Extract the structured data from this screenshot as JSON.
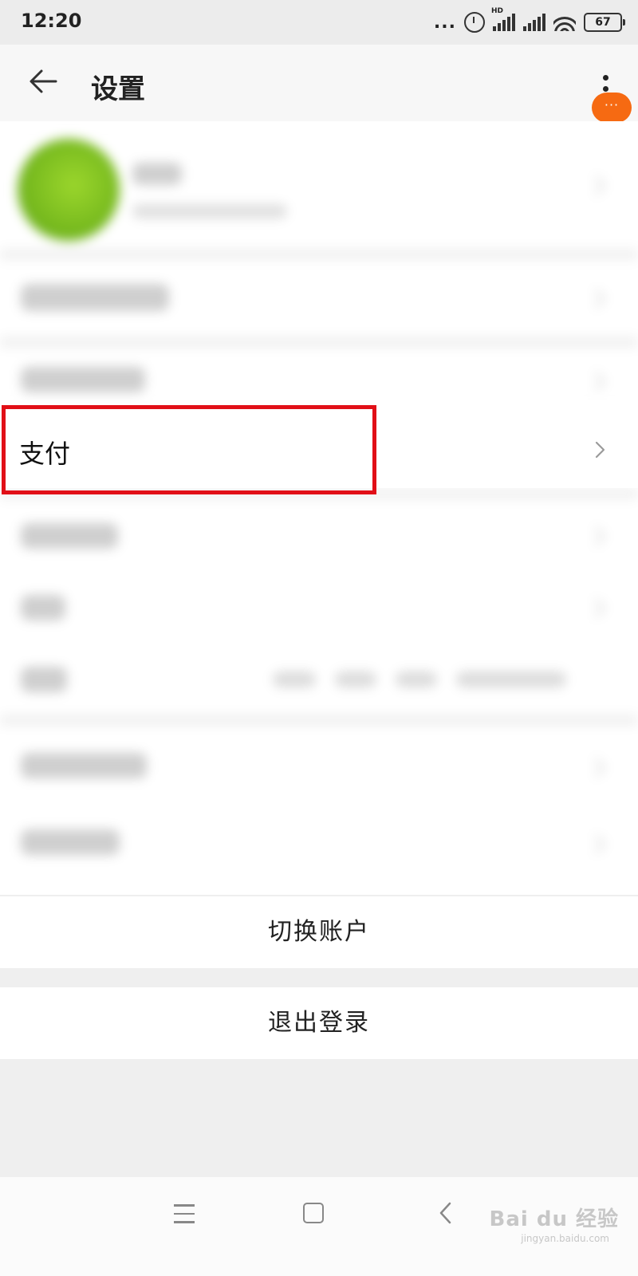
{
  "status_bar": {
    "time": "12:20",
    "dots": "...",
    "network_label": "HD",
    "battery": "67",
    "icons": [
      "alarm-icon",
      "signal-icon",
      "signal-icon",
      "wifi-icon",
      "battery-icon"
    ]
  },
  "header": {
    "title": "设置",
    "back_icon": "arrow-left-icon",
    "menu_icon": "more-vertical-icon",
    "badge_text": "···",
    "badge_color": "#f66a12"
  },
  "list": {
    "payment_label": "支付",
    "chevron_icon": "chevron-right-icon",
    "highlight_color": "#e10f17"
  },
  "actions": {
    "switch_account": "切换账户",
    "logout": "退出登录"
  },
  "nav": {
    "icons": [
      "menu-icon",
      "home-icon",
      "back-icon"
    ],
    "watermark": "Bai du 经验",
    "watermark_url": "jingyan.baidu.com"
  }
}
